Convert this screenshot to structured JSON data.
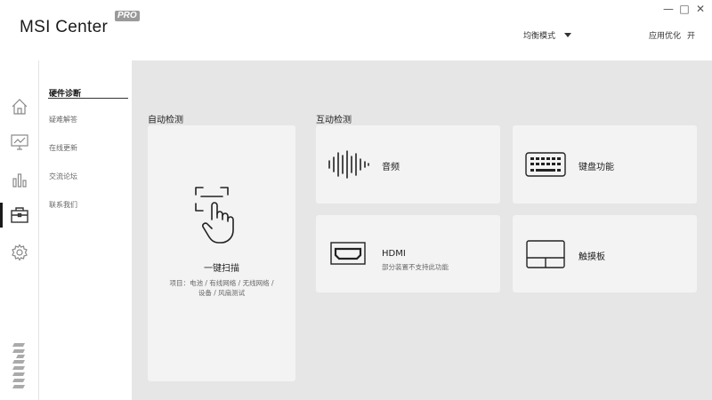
{
  "app": {
    "title": "MSI Center",
    "badge": "PRO",
    "window_controls": [
      "—",
      "□",
      "✕"
    ]
  },
  "header": {
    "mode_select": "均衡模式",
    "app_optimization_label": "应用优化",
    "app_optimization_value": "开"
  },
  "rail": {
    "items": [
      "home-icon",
      "monitor-icon",
      "chart-icon",
      "toolbox-icon",
      "gear-icon"
    ],
    "active_index": 3,
    "logo": "msi"
  },
  "submenu": {
    "items": [
      {
        "label": "硬件诊断",
        "active": true
      },
      {
        "label": "疑难解答",
        "active": false
      },
      {
        "label": "在线更新",
        "active": false
      },
      {
        "label": "交流论坛",
        "active": false
      },
      {
        "label": "联系我们",
        "active": false
      }
    ]
  },
  "auto_check": {
    "title": "自动检测",
    "scan_label": "一键扫描",
    "scan_desc_line1": "项目：电池 / 有线网络 / 无线网络 /",
    "scan_desc_line2": "设备 / 风扇测试"
  },
  "interactive_check": {
    "title": "互动检测",
    "cards": [
      {
        "label": "音频",
        "sub": "",
        "icon": "audio-wave-icon"
      },
      {
        "label": "键盘功能",
        "sub": "",
        "icon": "keyboard-icon"
      },
      {
        "label": "HDMI",
        "sub": "部分装置不支持此功能",
        "icon": "hdmi-icon"
      },
      {
        "label": "触摸板",
        "sub": "",
        "icon": "touchpad-icon"
      }
    ]
  },
  "colors": {
    "background": "#e6e6e6",
    "panel": "#ffffff",
    "card": "#f3f3f3",
    "text": "#222222"
  }
}
